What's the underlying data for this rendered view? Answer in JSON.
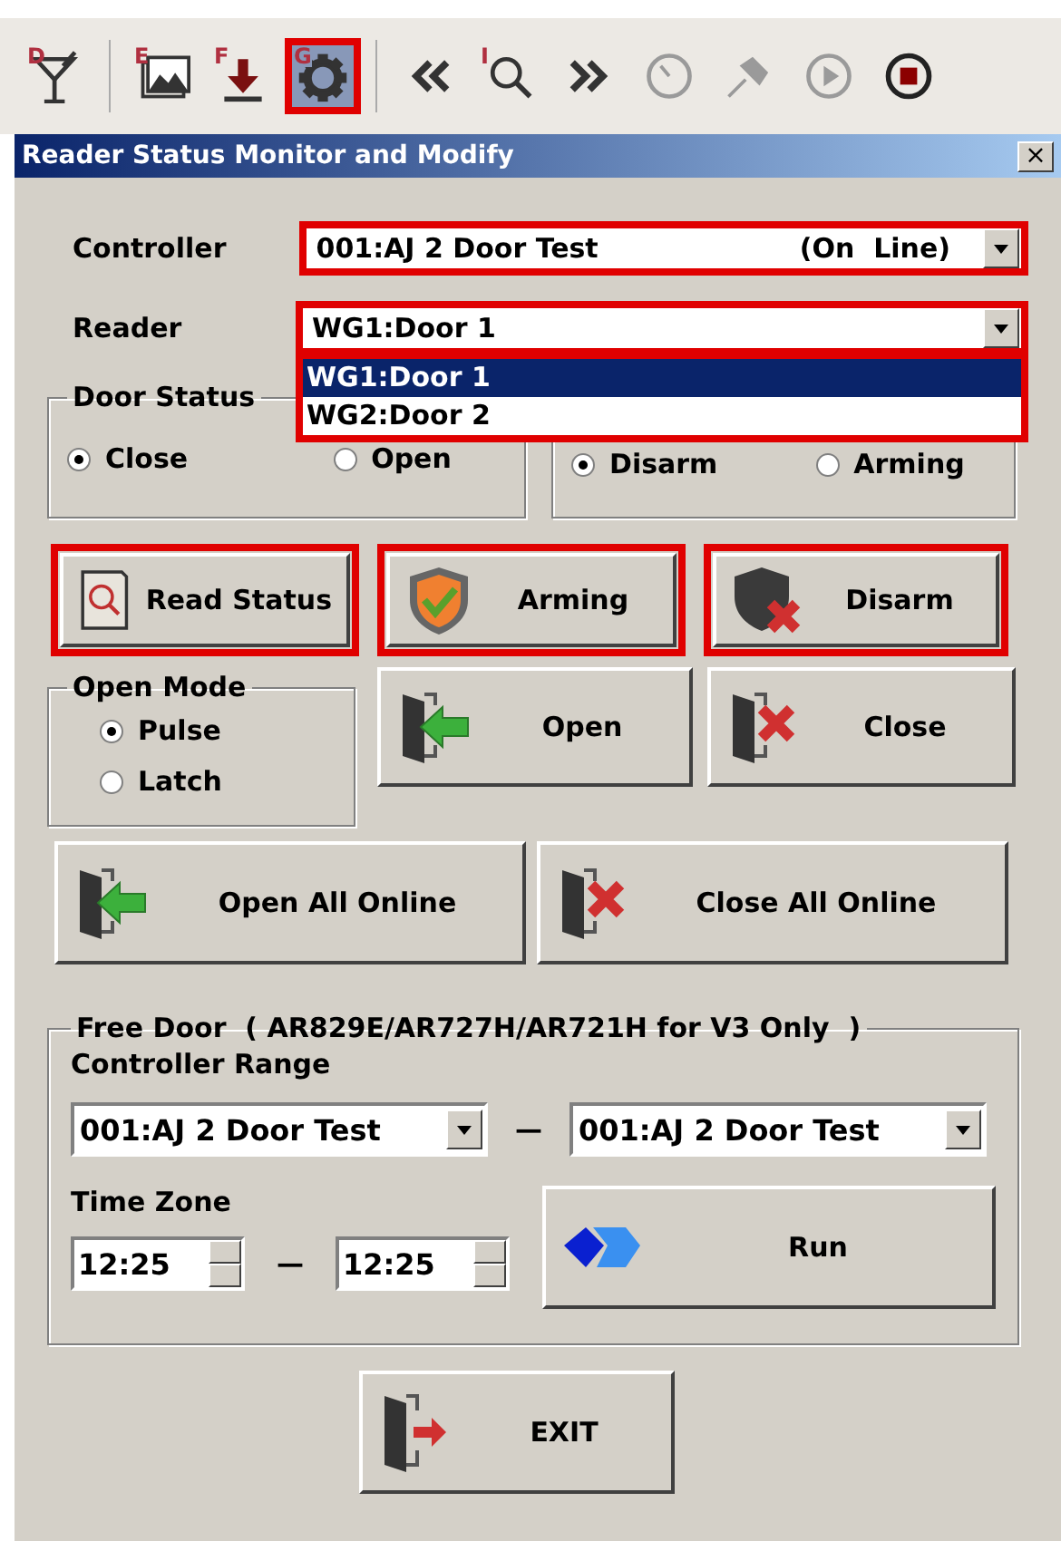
{
  "toolbar": [
    {
      "kind": "glass",
      "letter": "D",
      "disabled": false,
      "selected": false,
      "highlighted": false
    },
    {
      "kind": "picture",
      "letter": "E",
      "disabled": false,
      "selected": false,
      "highlighted": false
    },
    {
      "kind": "download",
      "letter": "F",
      "disabled": false,
      "selected": false,
      "highlighted": false
    },
    {
      "kind": "gear",
      "letter": "G",
      "disabled": false,
      "selected": true,
      "highlighted": true
    },
    {
      "kind": "prev",
      "disabled": false,
      "selected": false,
      "highlighted": false
    },
    {
      "kind": "search",
      "letter": "I",
      "disabled": false,
      "selected": false,
      "highlighted": false
    },
    {
      "kind": "next",
      "disabled": false,
      "selected": false,
      "highlighted": false
    },
    {
      "kind": "clock",
      "disabled": true,
      "selected": false,
      "highlighted": false
    },
    {
      "kind": "pin",
      "disabled": true,
      "selected": false,
      "highlighted": false
    },
    {
      "kind": "play",
      "disabled": true,
      "selected": false,
      "highlighted": false
    },
    {
      "kind": "stop",
      "disabled": false,
      "selected": false,
      "highlighted": false
    }
  ],
  "window": {
    "title": "Reader Status Monitor and Modify",
    "close": "×"
  },
  "controller": {
    "label": "Controller",
    "value": "001:AJ 2 Door Test",
    "status": "(On  Line)",
    "highlighted": true
  },
  "reader": {
    "label": "Reader",
    "value": "WG1:Door 1",
    "expanded": true,
    "highlighted": true,
    "options": [
      {
        "label": "WG1:Door 1",
        "selected": true
      },
      {
        "label": "WG2:Door 2",
        "selected": false
      }
    ]
  },
  "door_status": {
    "title": "Door Status",
    "options": [
      {
        "label": "Close",
        "selected": true
      },
      {
        "label": "Open",
        "selected": false
      }
    ]
  },
  "alarm_status": {
    "options": [
      {
        "label": "Disarm",
        "selected": true
      },
      {
        "label": "Arming",
        "selected": false
      }
    ]
  },
  "action_buttons": [
    {
      "kind": "read",
      "label": "Read Status",
      "highlighted": true
    },
    {
      "kind": "arm",
      "label": "Arming",
      "highlighted": true
    },
    {
      "kind": "disarm",
      "label": "Disarm",
      "highlighted": true
    }
  ],
  "open_mode": {
    "title": "Open Mode",
    "options": [
      {
        "label": "Pulse",
        "selected": true
      },
      {
        "label": "Latch",
        "selected": false
      }
    ]
  },
  "door_buttons": [
    {
      "kind": "open",
      "label": "Open",
      "highlighted": false
    },
    {
      "kind": "close",
      "label": "Close",
      "highlighted": false
    }
  ],
  "all_buttons": [
    {
      "kind": "open",
      "label": "Open All Online",
      "highlighted": false
    },
    {
      "kind": "close",
      "label": "Close All Online",
      "highlighted": false
    }
  ],
  "free_door": {
    "title": "Free Door  ( AR829E/AR727H/AR721H for V3 Only  )",
    "range_label": "Controller Range",
    "range_from": "001:AJ 2 Door Test",
    "range_sep": "—",
    "range_to": "001:AJ 2 Door Test",
    "time_label": "Time Zone",
    "time_from": "12:25",
    "time_sep": "—",
    "time_to": "12:25",
    "run": {
      "label": "Run"
    }
  },
  "exit": {
    "label": "EXIT"
  }
}
